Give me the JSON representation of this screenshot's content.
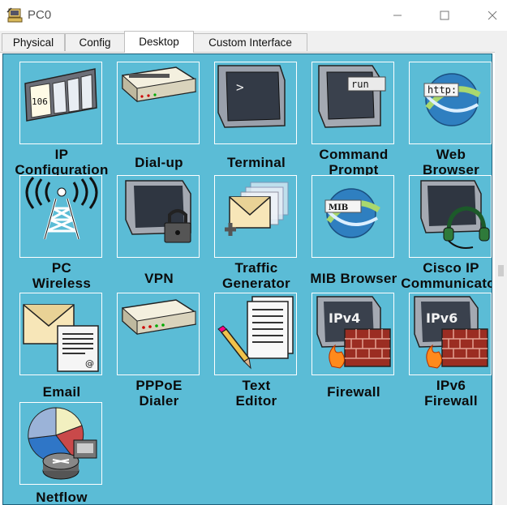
{
  "window": {
    "title": "PC0",
    "minimize": "—",
    "maximize": "☐",
    "close": "✕"
  },
  "tabs": [
    {
      "label": "Physical"
    },
    {
      "label": "Config"
    },
    {
      "label": "Desktop",
      "active": true
    },
    {
      "label": "Custom Interface"
    }
  ],
  "colors": {
    "panel": "#5bbcd6",
    "border": "#1e5f7a"
  },
  "apps": [
    {
      "line1": "IP",
      "line2": "Configuration",
      "icon": "ip-configuration-icon",
      "badge": "106"
    },
    {
      "line1": "Dial-up",
      "line2": "",
      "icon": "modem-icon"
    },
    {
      "line1": "Terminal",
      "line2": "",
      "icon": "terminal-icon",
      "badge": ">"
    },
    {
      "line1": "Command",
      "line2": "Prompt",
      "icon": "command-prompt-icon",
      "badge": "run"
    },
    {
      "line1": "Web",
      "line2": "Browser",
      "icon": "web-browser-icon",
      "badge": "http:"
    },
    {
      "line1": "PC",
      "line2": "Wireless",
      "icon": "wireless-tower-icon"
    },
    {
      "line1": "VPN",
      "line2": "",
      "icon": "vpn-lock-icon"
    },
    {
      "line1": "Traffic",
      "line2": "Generator",
      "icon": "traffic-generator-icon"
    },
    {
      "line1": "MIB Browser",
      "line2": "",
      "icon": "mib-browser-icon",
      "badge": "MIB"
    },
    {
      "line1": "Cisco IP",
      "line2": "Communicator",
      "icon": "ip-communicator-icon"
    },
    {
      "line1": "Email",
      "line2": "",
      "icon": "email-icon"
    },
    {
      "line1": "PPPoE",
      "line2": "Dialer",
      "icon": "pppoe-dialer-icon"
    },
    {
      "line1": "Text",
      "line2": "Editor",
      "icon": "text-editor-icon"
    },
    {
      "line1": "Firewall",
      "line2": "",
      "icon": "firewall-ipv4-icon",
      "badge": "IPv4"
    },
    {
      "line1": "IPv6",
      "line2": "Firewall",
      "icon": "firewall-ipv6-icon",
      "badge": "IPv6"
    },
    {
      "line1": "Netflow",
      "line2": "",
      "icon": "netflow-icon"
    }
  ]
}
